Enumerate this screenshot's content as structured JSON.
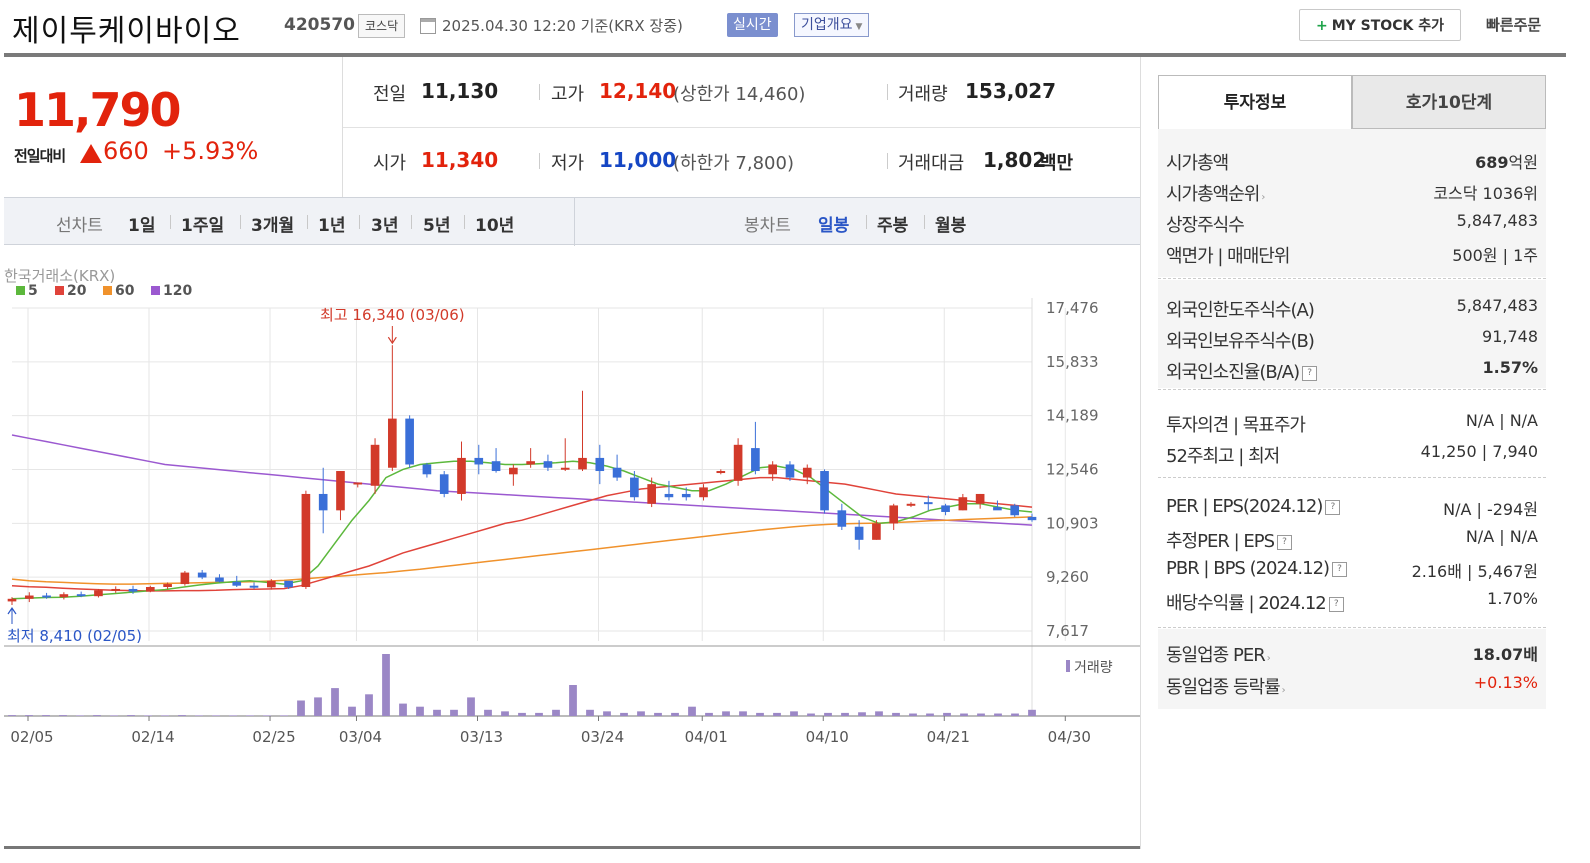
{
  "header": {
    "stock_name": "제이투케이바이오",
    "stock_code": "420570",
    "market": "코스닥",
    "datetime": "2025.04.30 12:20  기준(KRX 장중)",
    "live_label": "실시간",
    "overview_label": "기업개요",
    "mystock_label": "MY STOCK 추가",
    "quick_order_label": "빠른주문"
  },
  "price": {
    "current": "11,790",
    "change_label": "전일대비",
    "change": "660",
    "change_pct": "+5.93%"
  },
  "summary": {
    "prev_close": {
      "label": "전일",
      "value": "11,130"
    },
    "high": {
      "label": "고가",
      "value": "12,140",
      "sub": "(상한가 14,460)"
    },
    "volume": {
      "label": "거래량",
      "value": "153,027"
    },
    "open": {
      "label": "시가",
      "value": "11,340"
    },
    "low": {
      "label": "저가",
      "value": "11,000",
      "sub": "(하한가 7,800)"
    },
    "trade_amount": {
      "label": "거래대금",
      "value": "1,802",
      "unit": "백만"
    }
  },
  "toolbar": {
    "line_chart_label": "선차트",
    "periods": [
      "1일",
      "1주일",
      "3개월",
      "1년",
      "3년",
      "5년",
      "10년"
    ],
    "candle_chart_label": "봉차트",
    "candle_periods": [
      "일봉",
      "주봉",
      "월봉"
    ],
    "active_candle": "일봉"
  },
  "chart_data": {
    "type": "candlestick",
    "source_label": "한국거래소(KRX)",
    "legend": [
      {
        "name": "5",
        "color": "#5cb83c"
      },
      {
        "name": "20",
        "color": "#e0433a"
      },
      {
        "name": "60",
        "color": "#f0922c"
      },
      {
        "name": "120",
        "color": "#9b59d0"
      }
    ],
    "y_ticks": [
      "17,476",
      "15,833",
      "14,189",
      "12,546",
      "10,903",
      "9,260",
      "7,617"
    ],
    "ylim": [
      7617,
      17476
    ],
    "x_ticks": [
      "02/05",
      "02/14",
      "02/25",
      "03/04",
      "03/13",
      "03/24",
      "04/01",
      "04/10",
      "04/21",
      "04/30"
    ],
    "x_tick_index": [
      0,
      7,
      14,
      19,
      26,
      33,
      39,
      46,
      53,
      60
    ],
    "max_annotation": "최고 16,340 (03/06)",
    "min_annotation": "최저 8,410 (02/05)",
    "volume_label": "거래량",
    "candles": [
      [
        8520,
        8650,
        8410,
        8600
      ],
      [
        8600,
        8800,
        8500,
        8700
      ],
      [
        8700,
        8780,
        8600,
        8650
      ],
      [
        8650,
        8800,
        8580,
        8740
      ],
      [
        8740,
        8820,
        8650,
        8680
      ],
      [
        8680,
        8900,
        8640,
        8860
      ],
      [
        8860,
        8980,
        8780,
        8900
      ],
      [
        8900,
        9000,
        8750,
        8820
      ],
      [
        8820,
        9000,
        8800,
        8960
      ],
      [
        8960,
        9100,
        8900,
        9050
      ],
      [
        9050,
        9450,
        9000,
        9400
      ],
      [
        9400,
        9480,
        9200,
        9250
      ],
      [
        9250,
        9350,
        9100,
        9120
      ],
      [
        9120,
        9300,
        8960,
        9000
      ],
      [
        9000,
        9100,
        8900,
        8950
      ],
      [
        8950,
        9200,
        8880,
        9150
      ],
      [
        9150,
        9100,
        8900,
        8950
      ],
      [
        8960,
        11900,
        8900,
        11800
      ],
      [
        11800,
        12600,
        10600,
        11300
      ],
      [
        11300,
        12500,
        11000,
        12500
      ],
      [
        12100,
        12150,
        12000,
        12150
      ],
      [
        12050,
        13500,
        11800,
        13300
      ],
      [
        12600,
        16340,
        12500,
        14100
      ],
      [
        14100,
        14200,
        12600,
        12700
      ],
      [
        12700,
        12750,
        12300,
        12400
      ],
      [
        12400,
        12500,
        11700,
        11800
      ],
      [
        11800,
        13400,
        11600,
        12900
      ],
      [
        12900,
        13300,
        12400,
        12700
      ],
      [
        12800,
        13200,
        12450,
        12500
      ],
      [
        12400,
        12700,
        12050,
        12600
      ],
      [
        12700,
        13200,
        12600,
        12800
      ],
      [
        12800,
        13000,
        12500,
        12600
      ],
      [
        12600,
        13500,
        12500,
        12600
      ],
      [
        12550,
        14950,
        12500,
        12900
      ],
      [
        12900,
        13300,
        12100,
        12500
      ],
      [
        12600,
        13000,
        12200,
        12300
      ],
      [
        12300,
        12500,
        11600,
        11700
      ],
      [
        11500,
        12300,
        11400,
        12100
      ],
      [
        11800,
        12200,
        11600,
        11700
      ],
      [
        11800,
        12000,
        11600,
        11700
      ],
      [
        11700,
        12100,
        11600,
        12000
      ],
      [
        12500,
        12550,
        12400,
        12500
      ],
      [
        12200,
        13500,
        12050,
        13300
      ],
      [
        13200,
        14000,
        12400,
        12500
      ],
      [
        12400,
        12800,
        12200,
        12700
      ],
      [
        12700,
        12800,
        12200,
        12300
      ],
      [
        12300,
        12700,
        12100,
        12600
      ],
      [
        12500,
        12550,
        11200,
        11300
      ],
      [
        11300,
        11500,
        10700,
        10800
      ],
      [
        10800,
        11000,
        10100,
        10400
      ],
      [
        10400,
        11000,
        10400,
        10900
      ],
      [
        10900,
        11500,
        10700,
        11450
      ],
      [
        11450,
        11550,
        11400,
        11500
      ],
      [
        11550,
        11750,
        11300,
        11500
      ],
      [
        11450,
        11500,
        11150,
        11250
      ],
      [
        11300,
        11800,
        11300,
        11700
      ],
      [
        11500,
        11800,
        11350,
        11800
      ],
      [
        11400,
        11600,
        11400,
        11300
      ],
      [
        11450,
        11500,
        11100,
        11150
      ],
      [
        11100,
        11200,
        10950,
        11000
      ]
    ],
    "volumes": [
      3,
      3,
      3,
      3,
      2,
      3,
      2,
      3,
      2,
      2,
      3,
      2,
      2,
      2,
      2,
      2,
      2,
      50,
      60,
      90,
      30,
      70,
      200,
      40,
      30,
      20,
      20,
      60,
      20,
      15,
      10,
      10,
      20,
      100,
      20,
      15,
      10,
      15,
      10,
      10,
      30,
      10,
      15,
      15,
      10,
      10,
      15,
      8,
      10,
      10,
      12,
      15,
      10,
      8,
      8,
      10,
      8,
      8,
      8,
      8,
      20
    ],
    "ma5": [
      8600,
      8620,
      8640,
      8650,
      8680,
      8720,
      8760,
      8800,
      8840,
      8880,
      8950,
      9020,
      9080,
      9120,
      9150,
      9100,
      9050,
      9150,
      9600,
      10300,
      11000,
      11600,
      12300,
      12550,
      12700,
      12750,
      12800,
      12800,
      12750,
      12700,
      12700,
      12720,
      12750,
      12800,
      12750,
      12650,
      12500,
      12300,
      12100,
      12000,
      11900,
      11900,
      12100,
      12350,
      12600,
      12650,
      12550,
      12300,
      11900,
      11500,
      11100,
      10900,
      10950,
      11100,
      11300,
      11400,
      11500,
      11500,
      11400,
      11300,
      11250
    ],
    "ma20": [
      9000,
      8970,
      8950,
      8920,
      8900,
      8880,
      8860,
      8850,
      8840,
      8840,
      8850,
      8850,
      8860,
      8880,
      8890,
      8900,
      8910,
      9000,
      9150,
      9300,
      9450,
      9600,
      9800,
      10000,
      10150,
      10300,
      10450,
      10600,
      10750,
      10900,
      11000,
      11150,
      11300,
      11450,
      11600,
      11750,
      11850,
      11950,
      12000,
      12050,
      12100,
      12150,
      12200,
      12250,
      12300,
      12300,
      12250,
      12200,
      12150,
      12100,
      12000,
      11900,
      11800,
      11750,
      11700,
      11650,
      11600,
      11550,
      11500,
      11450,
      11400
    ],
    "ma60": [
      9200,
      9150,
      9120,
      9100,
      9080,
      9060,
      9050,
      9050,
      9060,
      9070,
      9080,
      9090,
      9100,
      9110,
      9120,
      9140,
      9160,
      9200,
      9240,
      9280,
      9320,
      9360,
      9400,
      9450,
      9500,
      9560,
      9620,
      9680,
      9740,
      9800,
      9860,
      9920,
      9980,
      10040,
      10100,
      10160,
      10220,
      10280,
      10340,
      10400,
      10460,
      10520,
      10580,
      10640,
      10700,
      10750,
      10800,
      10840,
      10870,
      10890,
      10900,
      10910,
      10930,
      10950,
      10980,
      11000,
      11020,
      11040,
      11060,
      11080,
      11100
    ],
    "ma120": [
      13600,
      13500,
      13400,
      13300,
      13200,
      13100,
      13000,
      12900,
      12800,
      12700,
      12650,
      12600,
      12550,
      12500,
      12450,
      12400,
      12350,
      12300,
      12250,
      12200,
      12150,
      12100,
      12050,
      12000,
      11950,
      11900,
      11870,
      11840,
      11810,
      11780,
      11750,
      11720,
      11690,
      11660,
      11630,
      11600,
      11570,
      11540,
      11510,
      11480,
      11450,
      11420,
      11390,
      11360,
      11330,
      11300,
      11270,
      11240,
      11210,
      11180,
      11150,
      11120,
      11090,
      11060,
      11030,
      11000,
      10970,
      10940,
      10910,
      10880,
      10850
    ]
  },
  "sidebar": {
    "tabs": [
      "투자정보",
      "호가10단계"
    ],
    "market_cap": {
      "label": "시가총액",
      "value": "689",
      "unit": "억원"
    },
    "market_cap_rank": {
      "label": "시가총액순위",
      "value": "코스닥 1036위"
    },
    "listed_shares": {
      "label": "상장주식수",
      "value": "5,847,483"
    },
    "par_value": {
      "label": "액면가 | 매매단위",
      "value": "500원 | 1주"
    },
    "foreign_limit": {
      "label": "외국인한도주식수(A)",
      "value": "5,847,483"
    },
    "foreign_hold": {
      "label": "외국인보유주식수(B)",
      "value": "91,748"
    },
    "foreign_ratio": {
      "label": "외국인소진율(B/A)",
      "value": "1.57%"
    },
    "opinion": {
      "label": "투자의견 | 목표주가",
      "value": "N/A | N/A"
    },
    "week52": {
      "label": "52주최고 | 최저",
      "value": "41,250 | 7,940"
    },
    "per_eps": {
      "label": "PER | EPS(2024.12)",
      "value": "N/A | -294원"
    },
    "est_per": {
      "label": "추정PER | EPS",
      "value": "N/A | N/A"
    },
    "pbr_bps": {
      "label": "PBR | BPS (2024.12)",
      "value": "2.16배 | 5,467원"
    },
    "dividend": {
      "label": "배당수익률 | 2024.12",
      "value": "1.70%"
    },
    "sector_per": {
      "label": "동일업종 PER",
      "value": "18.07배"
    },
    "sector_change": {
      "label": "동일업종 등락률",
      "value": "+0.13%"
    }
  }
}
